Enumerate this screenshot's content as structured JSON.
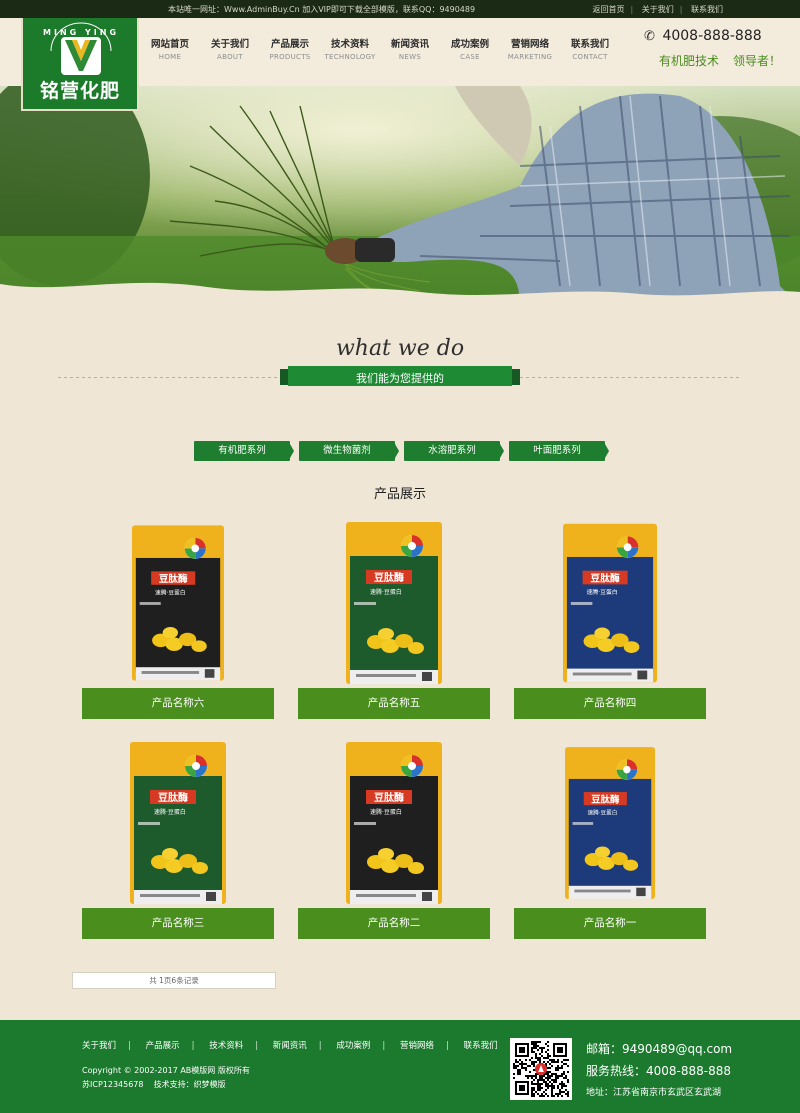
{
  "topbar": {
    "notice": "本站唯一网址：Www.AdminBuy.Cn 加入VIP即可下载全部模版，联系QQ：9490489",
    "links": [
      "返回首页",
      "关于我们",
      "联系我们"
    ]
  },
  "header": {
    "logo_ring_text": "MING YING",
    "logo_mark": "V",
    "brand": "铭营化肥",
    "nav": [
      {
        "cn": "网站首页",
        "en": "HOME"
      },
      {
        "cn": "关于我们",
        "en": "ABOUT"
      },
      {
        "cn": "产品展示",
        "en": "PRODUCTS"
      },
      {
        "cn": "技术资料",
        "en": "TECHNOLOGY"
      },
      {
        "cn": "新闻资讯",
        "en": "NEWS"
      },
      {
        "cn": "成功案例",
        "en": "CASE"
      },
      {
        "cn": "营销网络",
        "en": "MARKETING"
      },
      {
        "cn": "联系我们",
        "en": "CONTACT"
      }
    ],
    "hotline": "4008-888-888",
    "slogan_1": "有机肥技术",
    "slogan_2": "领导者！"
  },
  "intro": {
    "heading_en": "what we do",
    "heading_cn": "我们能为您提供的"
  },
  "categories": [
    "有机肥系列",
    "微生物菌剂",
    "水溶肥系列",
    "叶面肥系列"
  ],
  "products": {
    "title": "产品展示",
    "pack_brand": "豆肽酶",
    "pack_subtitle": "速腾·豆蛋白",
    "pack_brand_en": "Doutaimei",
    "items": [
      {
        "name": "产品名称六",
        "color": "#1f1f1f"
      },
      {
        "name": "产品名称五",
        "color": "#1d5a2c"
      },
      {
        "name": "产品名称四",
        "color": "#1d3a7a"
      },
      {
        "name": "产品名称三",
        "color": "#1d5a2c"
      },
      {
        "name": "产品名称二",
        "color": "#1f1f1f"
      },
      {
        "name": "产品名称一",
        "color": "#1d3a7a"
      }
    ],
    "pager": "共 1页6条记录"
  },
  "footer": {
    "links": [
      "关于我们",
      "产品展示",
      "技术资料",
      "新闻资讯",
      "成功案例",
      "营销网络",
      "联系我们"
    ],
    "copyright": "Copyright © 2002-2017 AB模版网 版权所有",
    "icp": "苏ICP12345678",
    "support": "技术支持：织梦模版",
    "email": "邮箱：9490489@qq.com",
    "tel": "服务热线：4008-888-888",
    "address": "地址：江苏省南京市玄武区玄武湖"
  },
  "colors": {
    "green": "#1b7a2e",
    "leaf_green": "#4a8f1d",
    "gold": "#f0b21c",
    "paper": "#efe6d6"
  }
}
